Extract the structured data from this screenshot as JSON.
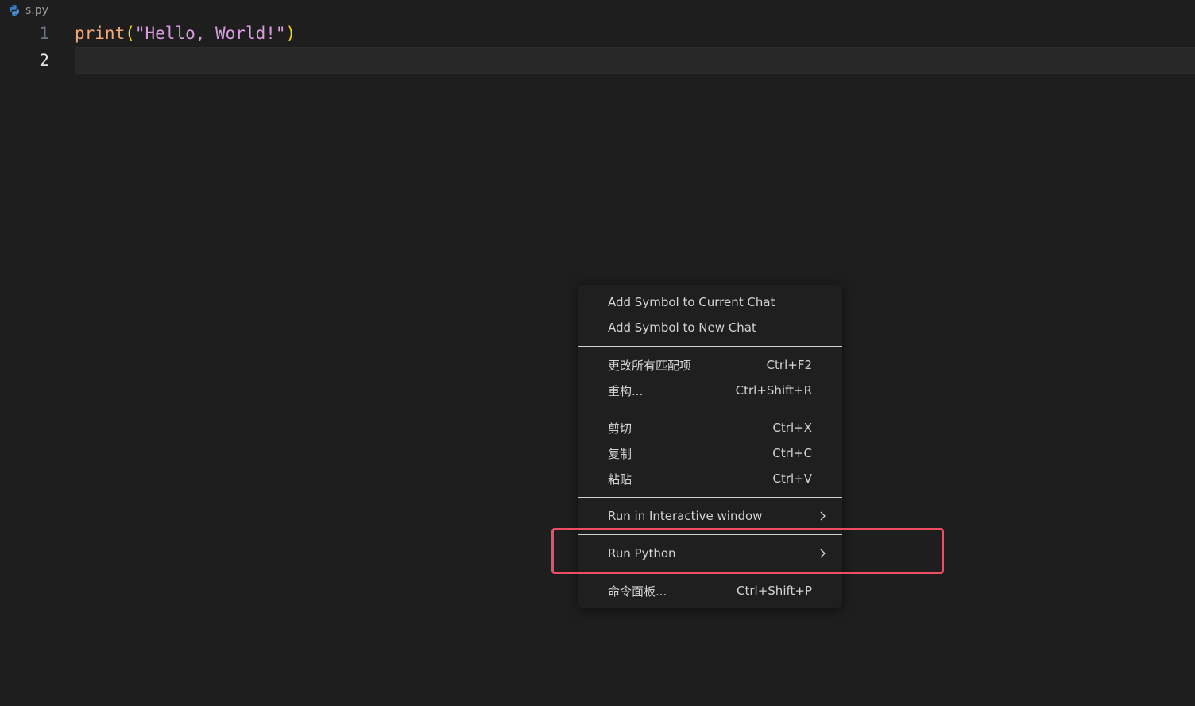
{
  "file": {
    "name": "s.py",
    "icon": "python-icon"
  },
  "editor": {
    "lines": [
      {
        "number": "1",
        "fn": "print",
        "open_paren": "(",
        "string": "\"Hello, World!\"",
        "close_paren": ")"
      },
      {
        "number": "2"
      }
    ]
  },
  "context_menu": {
    "groups": [
      {
        "items": [
          {
            "label": "Add Symbol to Current Chat",
            "shortcut": ""
          },
          {
            "label": "Add Symbol to New Chat",
            "shortcut": ""
          }
        ]
      },
      {
        "items": [
          {
            "label": "更改所有匹配项",
            "shortcut": "Ctrl+F2"
          },
          {
            "label": "重构...",
            "shortcut": "Ctrl+Shift+R"
          }
        ]
      },
      {
        "items": [
          {
            "label": "剪切",
            "shortcut": "Ctrl+X"
          },
          {
            "label": "复制",
            "shortcut": "Ctrl+C"
          },
          {
            "label": "粘贴",
            "shortcut": "Ctrl+V"
          }
        ]
      },
      {
        "items": [
          {
            "label": "Run in Interactive window",
            "submenu": true
          }
        ]
      },
      {
        "items": [
          {
            "label": "Run Python",
            "submenu": true,
            "highlighted": true
          }
        ]
      },
      {
        "items": [
          {
            "label": "命令面板...",
            "shortcut": "Ctrl+Shift+P"
          }
        ]
      }
    ]
  },
  "colors": {
    "background": "#1e1e1e",
    "highlight_box": "#ee4d63",
    "function": "#f0a878",
    "paren": "#ffd700",
    "string": "#d99be0"
  }
}
